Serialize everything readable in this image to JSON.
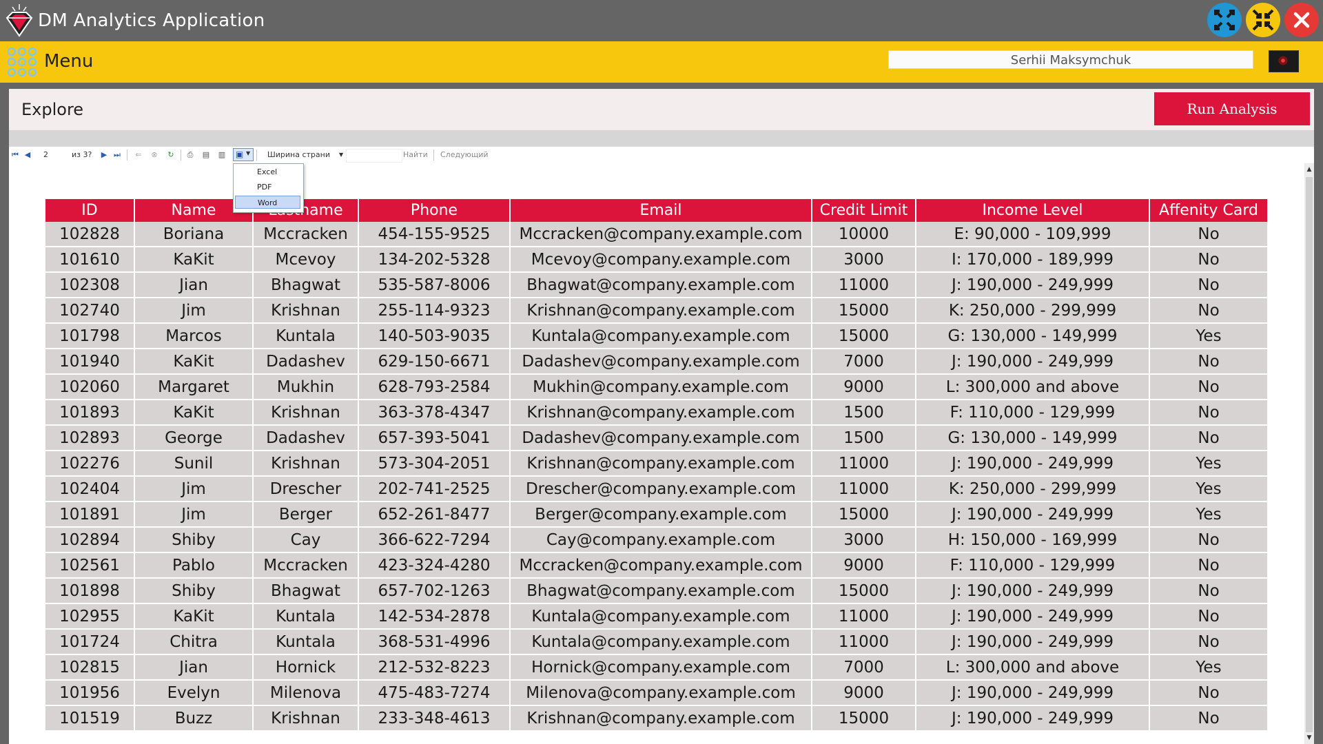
{
  "window": {
    "title": "DM Analytics Application",
    "buttons": {
      "maximize": {
        "icon": "expand-arrows-icon",
        "color": "#2196d3"
      },
      "restore": {
        "icon": "compress-arrows-icon",
        "color": "#f7c70e"
      },
      "close": {
        "icon": "close-icon",
        "color": "#e53935"
      }
    }
  },
  "menubar": {
    "menu_label": "Menu",
    "user_name": "Serhii Maksymchuk",
    "accent": "#f7c70e"
  },
  "explore": {
    "title": "Explore",
    "run_button": "Run Analysis",
    "run_color": "#dc143c"
  },
  "report_toolbar": {
    "page_current": "2",
    "page_of": "из 3?",
    "zoom": "Ширина страни",
    "find": "Найти",
    "next": "Следующий",
    "export_menu": [
      "Excel",
      "PDF",
      "Word"
    ],
    "export_selected": "Word"
  },
  "table": {
    "columns": [
      "ID",
      "Name",
      "Lastname",
      "Phone",
      "Email",
      "Credit Limit",
      "Income Level",
      "Affenity Card"
    ],
    "rows": [
      [
        "102828",
        "Boriana",
        "Mccracken",
        "454-155-9525",
        "Mccracken@company.example.com",
        "10000",
        "E: 90,000 - 109,999",
        "No"
      ],
      [
        "101610",
        "KaKit",
        "Mcevoy",
        "134-202-5328",
        "Mcevoy@company.example.com",
        "3000",
        "I: 170,000 - 189,999",
        "No"
      ],
      [
        "102308",
        "Jian",
        "Bhagwat",
        "535-587-8006",
        "Bhagwat@company.example.com",
        "11000",
        "J: 190,000 - 249,999",
        "No"
      ],
      [
        "102740",
        "Jim",
        "Krishnan",
        "255-114-9323",
        "Krishnan@company.example.com",
        "15000",
        "K: 250,000 - 299,999",
        "No"
      ],
      [
        "101798",
        "Marcos",
        "Kuntala",
        "140-503-9035",
        "Kuntala@company.example.com",
        "15000",
        "G: 130,000 - 149,999",
        "Yes"
      ],
      [
        "101940",
        "KaKit",
        "Dadashev",
        "629-150-6671",
        "Dadashev@company.example.com",
        "7000",
        "J: 190,000 - 249,999",
        "No"
      ],
      [
        "102060",
        "Margaret",
        "Mukhin",
        "628-793-2584",
        "Mukhin@company.example.com",
        "9000",
        "L: 300,000 and above",
        "No"
      ],
      [
        "101893",
        "KaKit",
        "Krishnan",
        "363-378-4347",
        "Krishnan@company.example.com",
        "1500",
        "F: 110,000 - 129,999",
        "No"
      ],
      [
        "102893",
        "George",
        "Dadashev",
        "657-393-5041",
        "Dadashev@company.example.com",
        "1500",
        "G: 130,000 - 149,999",
        "No"
      ],
      [
        "102276",
        "Sunil",
        "Krishnan",
        "573-304-2051",
        "Krishnan@company.example.com",
        "11000",
        "J: 190,000 - 249,999",
        "Yes"
      ],
      [
        "102404",
        "Jim",
        "Drescher",
        "202-741-2525",
        "Drescher@company.example.com",
        "11000",
        "K: 250,000 - 299,999",
        "Yes"
      ],
      [
        "101891",
        "Jim",
        "Berger",
        "652-261-8477",
        "Berger@company.example.com",
        "15000",
        "J: 190,000 - 249,999",
        "Yes"
      ],
      [
        "102894",
        "Shiby",
        "Cay",
        "366-622-7294",
        "Cay@company.example.com",
        "3000",
        "H: 150,000 - 169,999",
        "No"
      ],
      [
        "102561",
        "Pablo",
        "Mccracken",
        "423-324-4280",
        "Mccracken@company.example.com",
        "9000",
        "F: 110,000 - 129,999",
        "No"
      ],
      [
        "101898",
        "Shiby",
        "Bhagwat",
        "657-702-1263",
        "Bhagwat@company.example.com",
        "15000",
        "J: 190,000 - 249,999",
        "No"
      ],
      [
        "102955",
        "KaKit",
        "Kuntala",
        "142-534-2878",
        "Kuntala@company.example.com",
        "11000",
        "J: 190,000 - 249,999",
        "No"
      ],
      [
        "101724",
        "Chitra",
        "Kuntala",
        "368-531-4996",
        "Kuntala@company.example.com",
        "11000",
        "J: 190,000 - 249,999",
        "No"
      ],
      [
        "102815",
        "Jian",
        "Hornick",
        "212-532-8223",
        "Hornick@company.example.com",
        "7000",
        "L: 300,000 and above",
        "Yes"
      ],
      [
        "101956",
        "Evelyn",
        "Milenova",
        "475-483-7274",
        "Milenova@company.example.com",
        "9000",
        "J: 190,000 - 249,999",
        "No"
      ],
      [
        "101519",
        "Buzz",
        "Krishnan",
        "233-348-4613",
        "Krishnan@company.example.com",
        "15000",
        "J: 190,000 - 249,999",
        "No"
      ]
    ]
  }
}
